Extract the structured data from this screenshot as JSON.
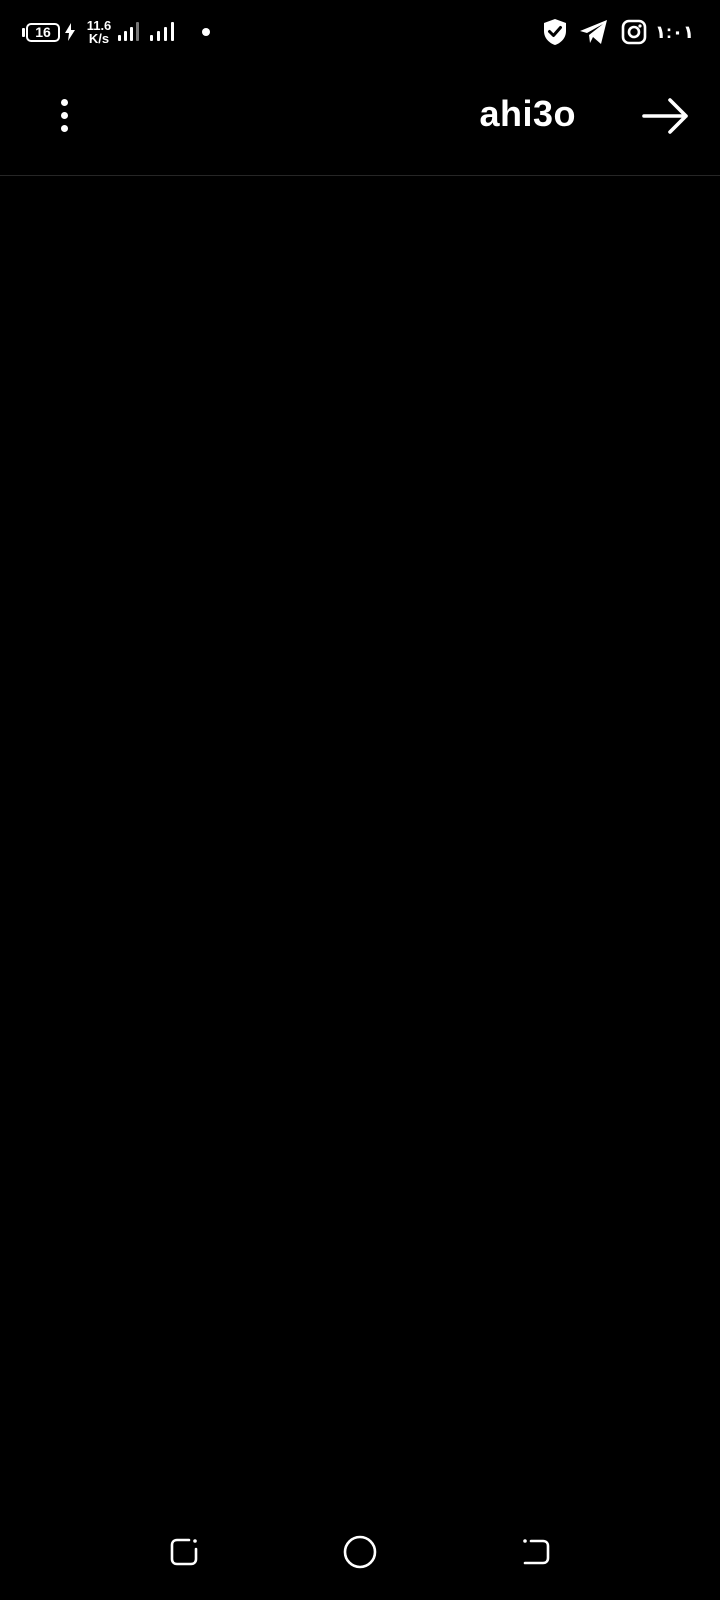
{
  "status_bar": {
    "battery_level": "16",
    "net_speed_value": "11.6",
    "net_speed_unit": "K/s",
    "clock": "١:٠١",
    "icons": [
      "battery-icon",
      "charging-bolt-icon",
      "signal-bars-icon",
      "signal-bars-icon",
      "notification-dot-icon",
      "vpn-shield-icon",
      "telegram-icon",
      "instagram-icon"
    ]
  },
  "header": {
    "username": "ahi3o",
    "more_icon": "more-vertical-icon",
    "back_icon": "arrow-right-icon"
  },
  "nav_bar": {
    "icons": [
      "recent-apps-icon",
      "home-icon",
      "back-icon"
    ]
  },
  "colors": {
    "background": "#000000",
    "foreground": "#ffffff",
    "divider": "#262626",
    "signal_dim": "#777777"
  }
}
